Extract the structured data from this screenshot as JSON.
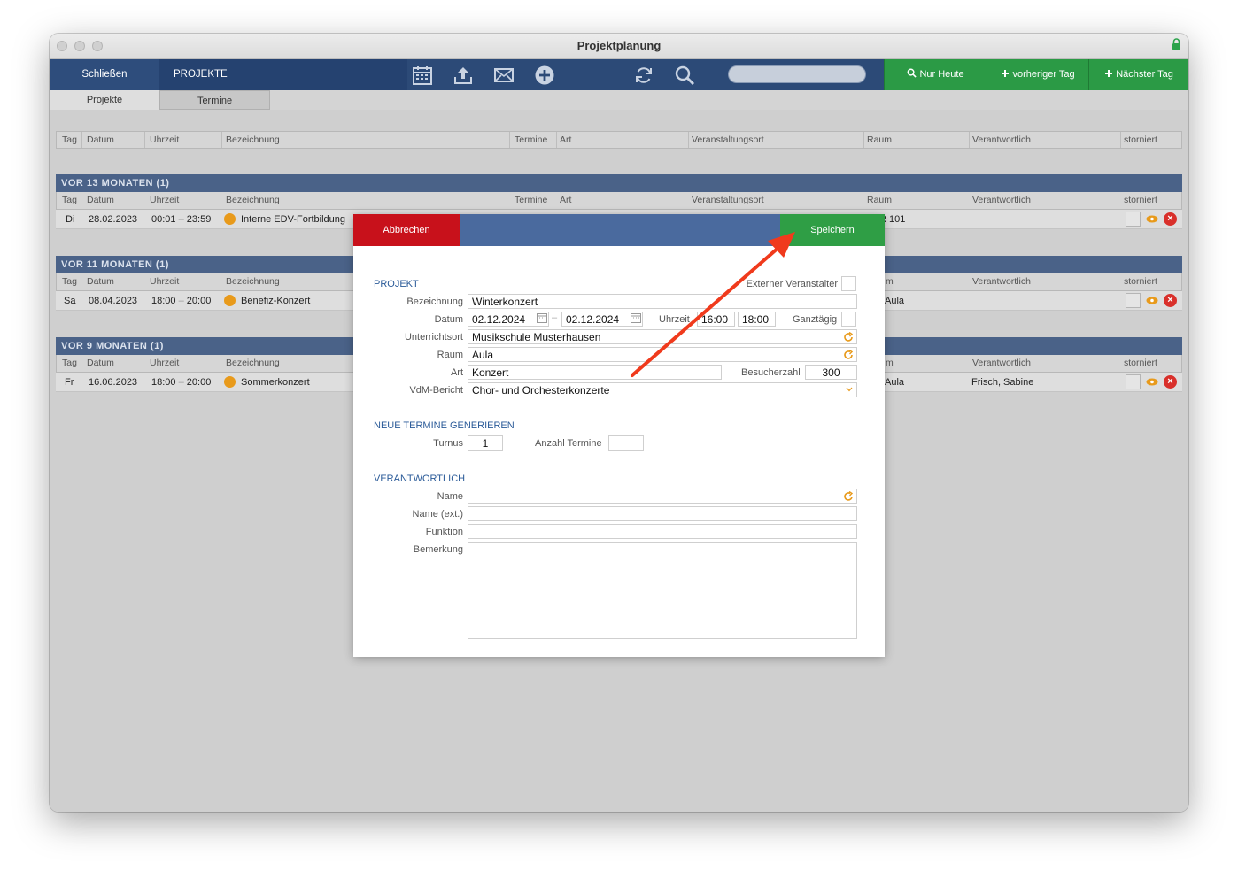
{
  "window": {
    "title": "Projektplanung"
  },
  "toolbar": {
    "close_label": "Schließen",
    "section_label": "PROJEKTE",
    "icons": [
      "calendar-icon",
      "upload-icon",
      "mail-icon",
      "add-icon",
      "refresh-icon",
      "search-icon"
    ],
    "search_value": "",
    "today_label": "Nur Heute",
    "prev_label": "vorheriger Tag",
    "next_label": "Nächster Tag"
  },
  "tabs": [
    "Projekte",
    "Termine"
  ],
  "columns": [
    "Tag",
    "Datum",
    "Uhrzeit",
    "Bezeichnung",
    "Termine",
    "Art",
    "Veranstaltungsort",
    "Raum",
    "Verantwortlich",
    "storniert"
  ],
  "groups": [
    {
      "title": "VOR 13 MONATEN (1)",
      "headers": [
        "Tag",
        "Datum",
        "Uhrzeit",
        "Bezeichnung",
        "Termine",
        "Art",
        "Veranstaltungsort",
        "Raum",
        "Verantwortlich",
        "storniert"
      ],
      "row": {
        "tag": "Di",
        "datum": "28.02.2023",
        "von": "00:01",
        "bis": "23:59",
        "bezeichnung": "Interne EDV-Fortbildung",
        "raum": "R 101",
        "verantwortlich": ""
      }
    },
    {
      "title": "VOR 11 MONATEN (1)",
      "headers": [
        "Tag",
        "Datum",
        "Uhrzeit",
        "Bezeichnung",
        "m",
        "Verantwortlich",
        "storniert"
      ],
      "row": {
        "tag": "Sa",
        "datum": "08.04.2023",
        "von": "18:00",
        "bis": "20:00",
        "bezeichnung": "Benefiz-Konzert",
        "raum": "Aula",
        "verantwortlich": ""
      }
    },
    {
      "title": "VOR 9 MONATEN (1)",
      "headers": [
        "Tag",
        "Datum",
        "Uhrzeit",
        "Bezeichnung",
        "m",
        "Verantwortlich",
        "storniert"
      ],
      "row": {
        "tag": "Fr",
        "datum": "16.06.2023",
        "von": "18:00",
        "bis": "20:00",
        "bezeichnung": "Sommerkonzert",
        "raum": "Aula",
        "verantwortlich": "Frisch, Sabine"
      }
    }
  ],
  "dash": "–",
  "modal": {
    "cancel_label": "Abbrechen",
    "save_label": "Speichern",
    "projekt": {
      "section": "PROJEKT",
      "extern_label": "Externer Veranstalter",
      "bezeichnung_label": "Bezeichnung",
      "bezeichnung": "Winterkonzert",
      "datum_label": "Datum",
      "datum_von": "02.12.2024",
      "datum_bis": "02.12.2024",
      "uhrzeit_label": "Uhrzeit",
      "zeit_von": "16:00",
      "zeit_bis": "18:00",
      "ganztaegig_label": "Ganztägig",
      "ort_label": "Unterrichtsort",
      "ort": "Musikschule Musterhausen",
      "raum_label": "Raum",
      "raum": "Aula",
      "art_label": "Art",
      "art": "Konzert",
      "besucher_label": "Besucherzahl",
      "besucher": "300",
      "vdm_label": "VdM-Bericht",
      "vdm": "Chor- und Orchesterkonzerte"
    },
    "termine": {
      "section": "NEUE TERMINE GENERIEREN",
      "turnus_label": "Turnus",
      "turnus": "1",
      "anzahl_label": "Anzahl Termine",
      "anzahl": ""
    },
    "verantwortlich": {
      "section": "VERANTWORTLICH",
      "name_label": "Name",
      "name": "",
      "name_ext_label": "Name (ext.)",
      "name_ext": "",
      "funktion_label": "Funktion",
      "funktion": "",
      "bemerkung_label": "Bemerkung",
      "bemerkung": ""
    }
  },
  "colors": {
    "toolbar": "#2c4a77",
    "green": "#2b9a45",
    "cancel": "#c8111b",
    "save": "#2f9e45",
    "annotation_arrow": "#f03a1c"
  }
}
